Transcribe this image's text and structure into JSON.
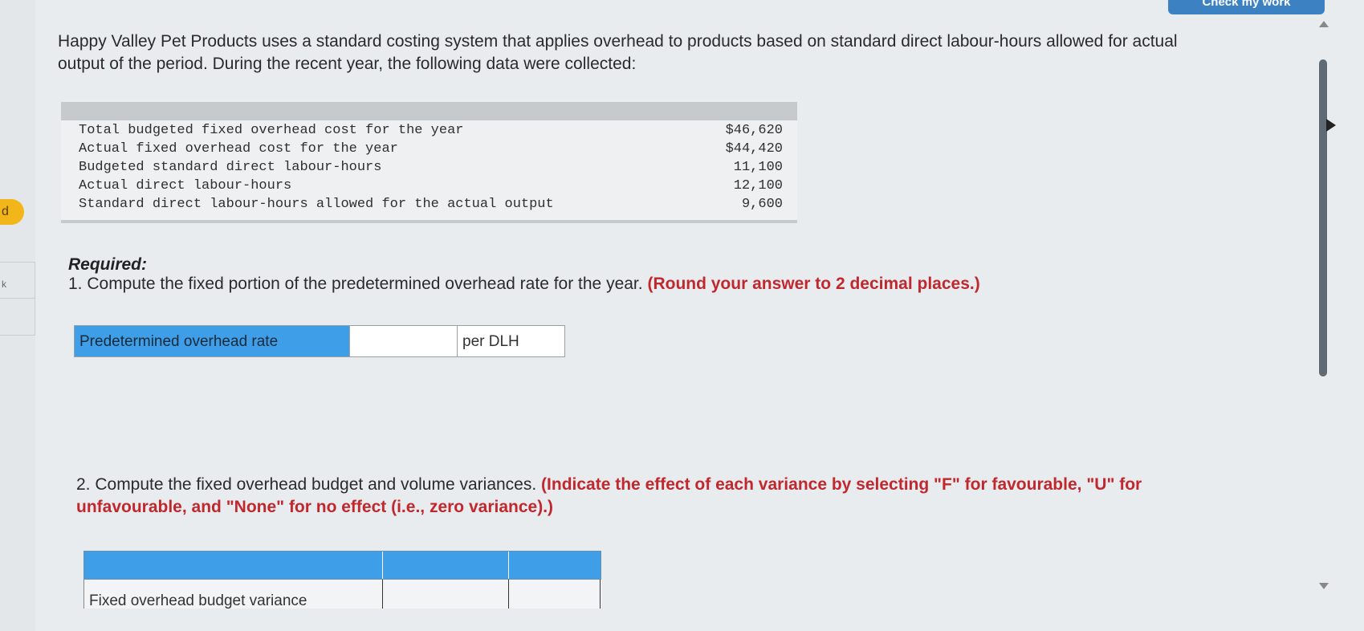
{
  "header": {
    "button_label": "Check my work"
  },
  "sidebar": {
    "badge_text": "d",
    "mark_text": "k"
  },
  "intro": "Happy Valley Pet Products uses a standard costing system that applies overhead to products based on standard direct labour-hours allowed for actual output of the period. During the recent year, the following data were collected:",
  "data_table": {
    "rows": [
      {
        "label": "Total budgeted fixed overhead cost for the year",
        "value": "$46,620"
      },
      {
        "label": "Actual fixed overhead cost for the year",
        "value": "$44,420"
      },
      {
        "label": "Budgeted standard direct labour-hours",
        "value": "11,100"
      },
      {
        "label": "Actual direct labour-hours",
        "value": "12,100"
      },
      {
        "label": "Standard direct labour-hours allowed for the actual output",
        "value": "9,600"
      }
    ]
  },
  "required": {
    "heading": "Required:",
    "q1_text": "1. Compute the fixed portion of the predetermined overhead rate for the year.",
    "q1_instruction": "(Round your answer to 2 decimal places.)",
    "rate_label": "Predetermined overhead rate",
    "rate_value": "",
    "rate_unit": "per DLH",
    "q2_text": "2. Compute the fixed overhead budget and volume variances.",
    "q2_instruction": "(Indicate the effect of each variance by selecting \"F\" for favourable, \"U\" for unfavourable, and \"None\" for no effect (i.e., zero variance).)"
  },
  "variance_table": {
    "rows": [
      {
        "label": "Fixed overhead budget variance"
      }
    ]
  }
}
